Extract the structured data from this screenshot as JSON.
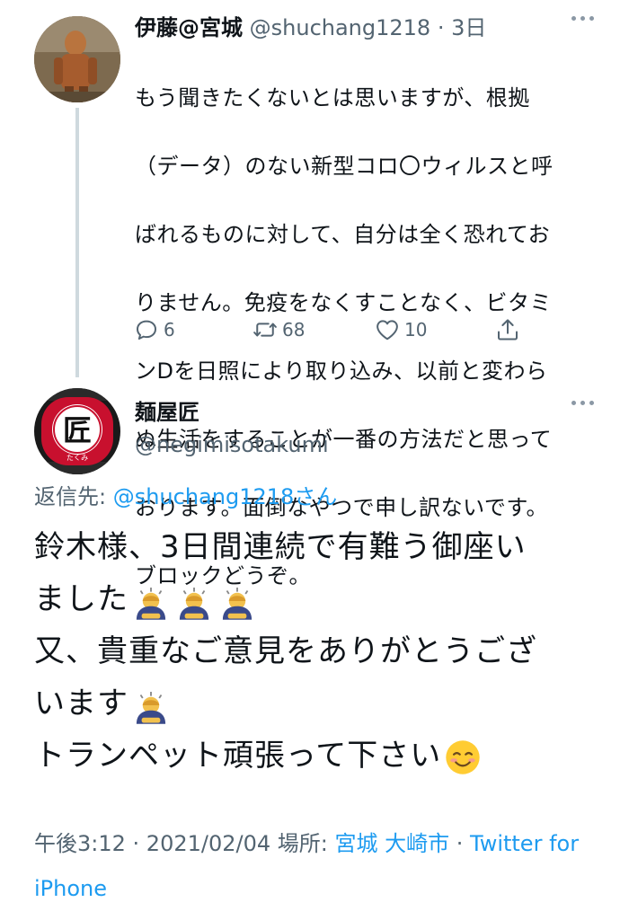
{
  "parent_tweet": {
    "name": "伊藤@宮城",
    "handle": "@shuchang1218",
    "dot": "·",
    "time": "3日",
    "body_lines": [
      "もう聞きたくないとは思いますが、根拠",
      "（データ）のない新型コロ〇ウィルスと呼",
      "ばれるものに対して、自分は全く恐れてお",
      "りません。免疫をなくすことなく、ビタミ",
      "ンDを日照により取り込み、以前と変わら",
      "ぬ生活をすることが一番の方法だと思って",
      "おります。面倒なやつで申し訳ないです。",
      "ブロックどうぞ。"
    ],
    "actions": {
      "reply_count": "6",
      "retweet_count": "68",
      "like_count": "10"
    }
  },
  "main_tweet": {
    "name": "麺屋匠",
    "handle": "@negimisotakumi",
    "avatar_kanji": "匠",
    "avatar_sub": "たくみ",
    "reply_prefix": "返信先: ",
    "reply_mention": "@shuchang1218さん",
    "body_lines": [
      "鈴木様、3日間連続で有難う御座い",
      "ました",
      "又、貴重なご意見をありがとうござ",
      "います",
      "トランペット頑張って下さい"
    ],
    "meta": {
      "time": "午後3:12",
      "sep": " · ",
      "date": "2021/02/04",
      "place_label": " 場所: ",
      "place": "宮城 大崎市",
      "sep2": " · ",
      "source": "Twitter for iPhone"
    }
  },
  "colors": {
    "link": "#1d9bf0",
    "muted": "#536471",
    "avatar_red": "#c8102e"
  },
  "icons": [
    "reply-icon",
    "retweet-icon",
    "like-icon",
    "share-icon",
    "more-icon",
    "bowing-person-emoji",
    "smiling-face-emoji"
  ]
}
